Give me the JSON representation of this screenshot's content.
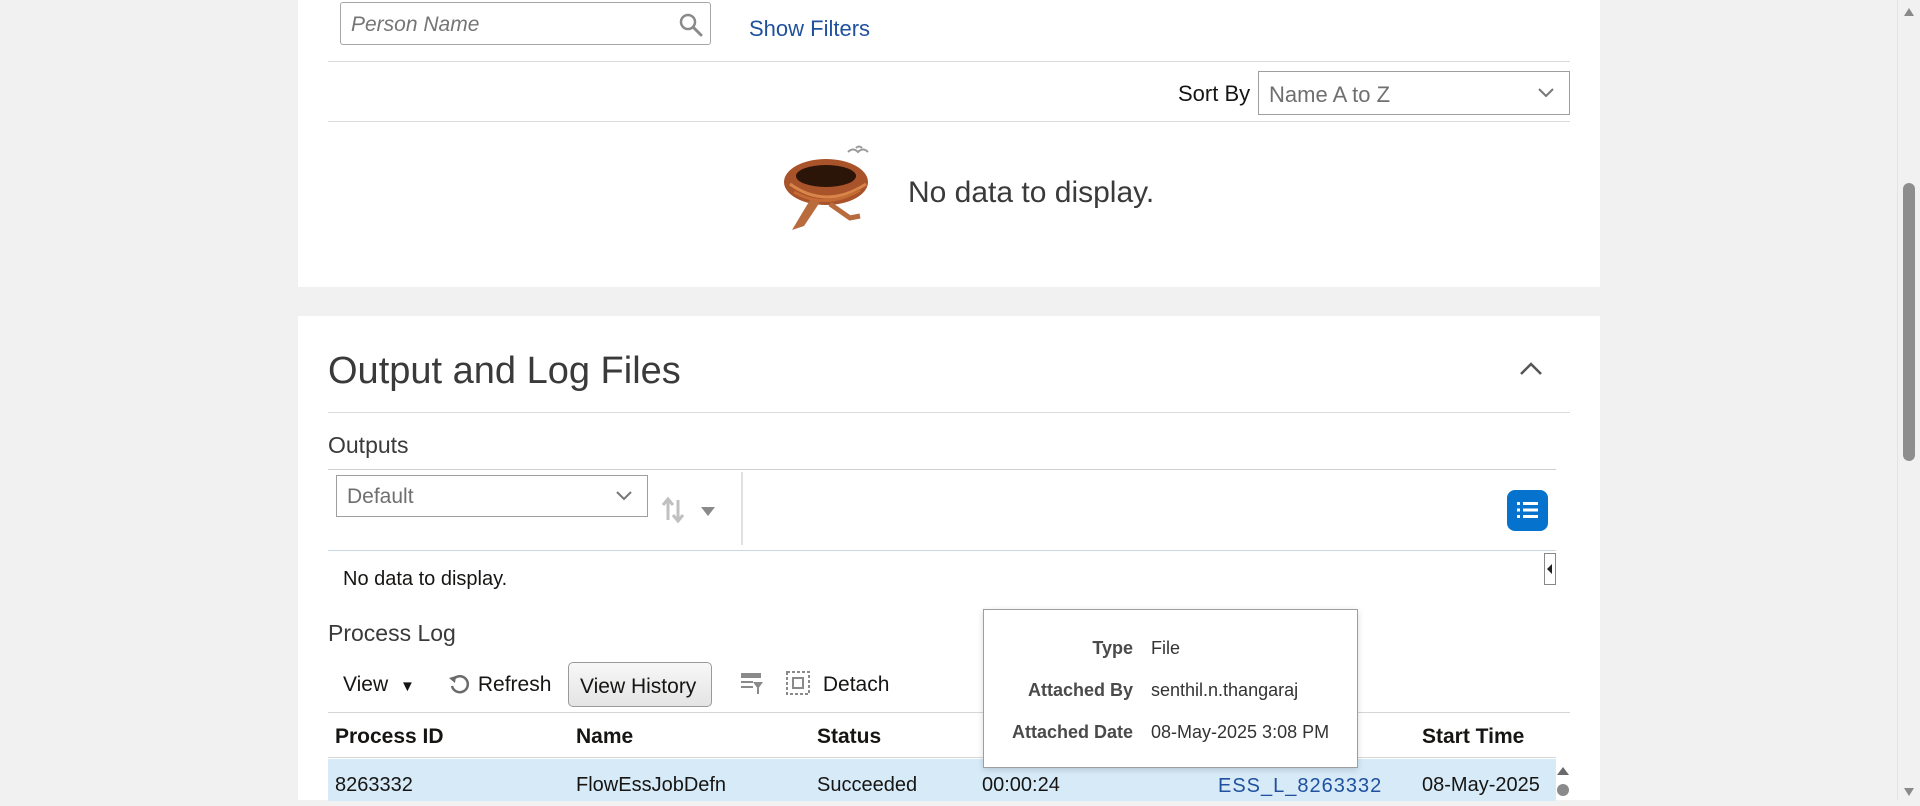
{
  "search": {
    "placeholder": "Person Name",
    "show_filters": "Show Filters"
  },
  "sort": {
    "label": "Sort By",
    "selected": "Name A to Z"
  },
  "empty_top": {
    "message": "No data to display."
  },
  "output_log": {
    "title": "Output and Log Files",
    "outputs": {
      "title": "Outputs",
      "view_selected": "Default",
      "empty": "No data to display."
    },
    "process_log": {
      "title": "Process Log",
      "toolbar": {
        "view": "View",
        "refresh": "Refresh",
        "view_history": "View History",
        "detach": "Detach"
      },
      "columns": [
        "Process ID",
        "Name",
        "Status",
        "",
        "",
        "Start Time"
      ],
      "rows": [
        {
          "process_id": "8263332",
          "name": "FlowEssJobDefn",
          "status": "Succeeded",
          "duration": "00:00:24",
          "log": "ESS_L_8263332",
          "start_time": "08-May-2025"
        }
      ]
    }
  },
  "tooltip": {
    "type_label": "Type",
    "type_value": "File",
    "attached_by_label": "Attached By",
    "attached_by_value": "senthil.n.thangaraj",
    "attached_date_label": "Attached Date",
    "attached_date_value": "08-May-2025 3:08 PM"
  },
  "colors": {
    "accent": "#0572ce",
    "link": "#20519e",
    "row_selected": "#d6eaf8",
    "background": "#f1f1f1"
  }
}
